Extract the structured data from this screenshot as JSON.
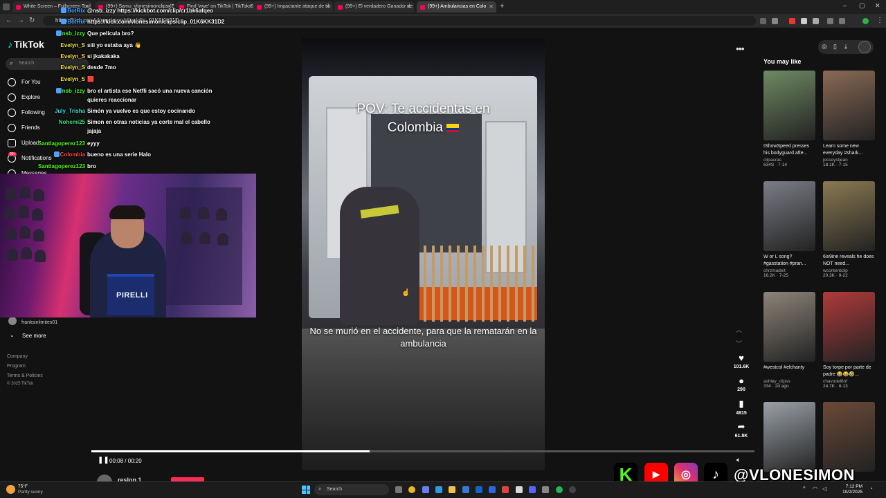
{
  "browser": {
    "tabs": [
      {
        "title": "White Screen – Fullscreen Tool",
        "active": false
      },
      {
        "title": "(99+) Samu_vlonesimonclips (E",
        "active": false
      },
      {
        "title": "Find 'wwe' on TikTok | TikTok Se",
        "active": false
      },
      {
        "title": "(99+) Impactante ataque de tib",
        "active": false
      },
      {
        "title": "(99+) El verdadero Ganador de",
        "active": false
      },
      {
        "title": "(99+) Ambulancias en Colo",
        "active": true
      }
    ],
    "new_tab": "+",
    "address": "https://kick.com/vlonesimon/clips/clip_01K6KK31D"
  },
  "tiktok": {
    "logo": "TikTok",
    "search_placeholder": "Search",
    "nav": [
      {
        "label": "For You",
        "icon": "home-icon",
        "active": false
      },
      {
        "label": "Explore",
        "icon": "compass-icon",
        "active": false
      },
      {
        "label": "Following",
        "icon": "following-icon",
        "active": false
      },
      {
        "label": "Friends",
        "icon": "friends-icon",
        "active": false
      },
      {
        "label": "Upload",
        "icon": "upload-icon",
        "active": false
      },
      {
        "label": "Notifications",
        "icon": "bell-icon",
        "active": false
      },
      {
        "label": "Messages",
        "icon": "message-icon",
        "active": false
      }
    ],
    "notif_badge": "99+",
    "followed_account": "franksinlimites01",
    "followed_account_top": "franksinlimites01",
    "see_more": "See more",
    "footer": [
      "Company",
      "Program",
      "Terms & Policies",
      "© 2025 TikTok"
    ]
  },
  "chat": [
    {
      "user": "BotRix",
      "color": "#4aa3ff",
      "badge": true,
      "msg": "@nsb_izzy https://kickbot.com/clip/cr1bk6afqeo"
    },
    {
      "user": "BotRix",
      "color": "#4aa3ff",
      "badge": true,
      "msg": "https://kick.com/vlonesimon/clips/clip_01K6KK31D2"
    },
    {
      "user": "nsb_izzy",
      "color": "#53fc18",
      "badge": true,
      "msg": "Que película bro?"
    },
    {
      "user": "Evelyn_S",
      "color": "#f0e04a",
      "badge": false,
      "msg": "siii yo estaba aya 👋"
    },
    {
      "user": "Evelyn_S",
      "color": "#f0e04a",
      "badge": false,
      "msg": "si jkakakaka"
    },
    {
      "user": "Evelyn_S",
      "color": "#f0e04a",
      "badge": false,
      "msg": "desde 7mo"
    },
    {
      "user": "Evelyn_S",
      "color": "#f0e04a",
      "badge": false,
      "msg": "🟥"
    },
    {
      "user": "nsb_izzy",
      "color": "#53fc18",
      "badge": true,
      "msg": "bro el artista ese Netfli sacó una nueva canción"
    },
    {
      "user": "",
      "color": "#fff",
      "badge": false,
      "msg": "quieres reaccionar"
    },
    {
      "user": "July_Trisha",
      "color": "#3ddcd4",
      "badge": false,
      "msg": "Simón ya vuelvo es que estoy cocinando"
    },
    {
      "user": "Nohemi25",
      "color": "#3ddc7b",
      "badge": false,
      "msg": "Simon en otras noticias ya corte mal el cabello"
    },
    {
      "user": "",
      "color": "#fff",
      "badge": false,
      "msg": "jajaja"
    },
    {
      "user": "Santiagoperez123",
      "color": "#53fc18",
      "badge": false,
      "msg": "eyyy"
    },
    {
      "user": "Colombia",
      "color": "#ff4646",
      "badge": true,
      "msg": "bueno es una serie Halo"
    },
    {
      "user": "Santiagoperez123",
      "color": "#53fc18",
      "badge": false,
      "msg": "bro"
    }
  ],
  "webcam": {
    "shirt_brand": "PIRELLI"
  },
  "video": {
    "title_text": "POV: Te accidentas en Colombia",
    "caption": "No se murió en el accidente, para que la rematarán en la ambulancia",
    "time": "00:08 / 00:20",
    "progress": 0.42,
    "next_user": "reslon 1"
  },
  "actions": {
    "likes": "101.6K",
    "comments": "290",
    "saves": "4815",
    "shares": "61.8K"
  },
  "right_rail": {
    "heading": "You may like",
    "cards": [
      {
        "title": "IShowSpeed presses his bodyguard afte...",
        "author": "clipauras",
        "stats": "634S · 7-14",
        "color": "#6f8a63"
      },
      {
        "title": "Learn some new everyday #shark...",
        "author": "jesseystjean",
        "stats": "18.1K · 7-15",
        "color": "#8a6a55"
      },
      {
        "title": "W or L song? #gasstation #pran...",
        "author": "chrzmadeit",
        "stats": "16.2K · 7-25",
        "color": "#7b7d86"
      },
      {
        "title": "6ix9ine reveals he does NOT need...",
        "author": "wcontentclip",
        "stats": "20.3K · 9-22",
        "color": "#8a7a52"
      },
      {
        "title": "#westcol #elchanty",
        "author": "ashley_clipss",
        "stats": "334 · 2d ago",
        "color": "#8d8478"
      },
      {
        "title": "Soy torpe por parte de padre 😂😂🤣...",
        "author": "chavodel8of",
        "stats": "24.7K · 8-13",
        "color": "#b03a3a"
      },
      {
        "title": "",
        "author": "",
        "stats": "",
        "color": "#9aa1a8"
      },
      {
        "title": "",
        "author": "",
        "stats": "",
        "color": "#6b4a38"
      }
    ]
  },
  "socials": {
    "handle": "@VLONESIMON",
    "icons": [
      "kick-icon",
      "youtube-icon",
      "instagram-icon",
      "tiktok-icon"
    ]
  },
  "taskbar": {
    "temp": "75°F",
    "weather": "Partly sunny",
    "search": "Search",
    "time": "7:12 PM",
    "date": "10/2/2025"
  }
}
